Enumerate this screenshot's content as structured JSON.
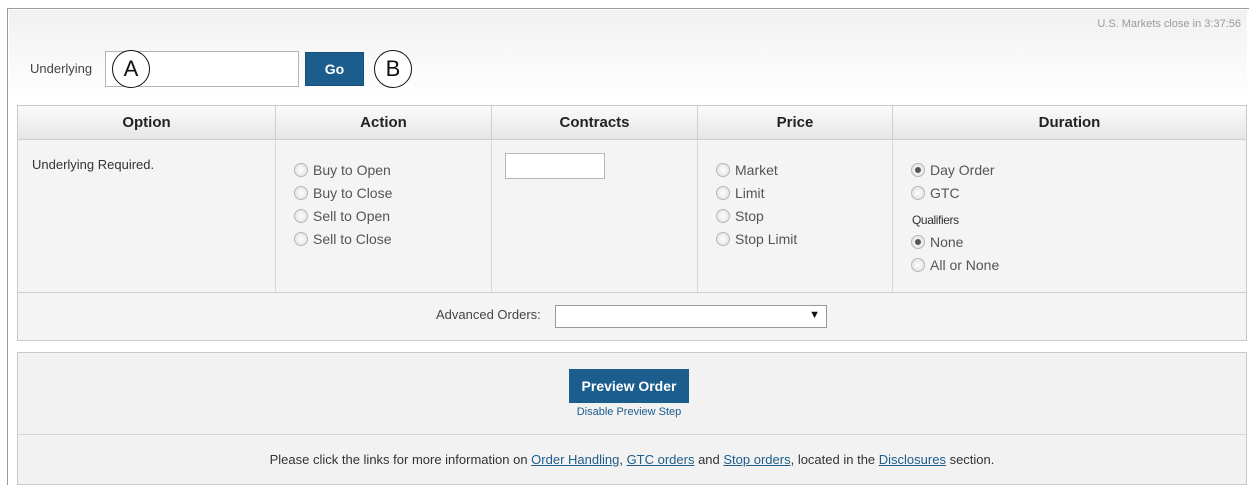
{
  "header": {
    "market_close": "U.S. Markets close in 3:37:56",
    "underlying_label": "Underlying",
    "underlying_value": "",
    "go_label": "Go",
    "callout_a": "A",
    "callout_b": "B"
  },
  "table": {
    "headers": [
      "Option",
      "Action",
      "Contracts",
      "Price",
      "Duration"
    ],
    "option_status": "Underlying Required.",
    "action_options": [
      "Buy to Open",
      "Buy to Close",
      "Sell to Open",
      "Sell to Close"
    ],
    "contracts_value": "",
    "price_options": [
      "Market",
      "Limit",
      "Stop",
      "Stop Limit"
    ],
    "duration_options": [
      "Day Order",
      "GTC"
    ],
    "duration_selected": "Day Order",
    "qualifiers_label": "Qualifiers",
    "qualifier_options": [
      "None",
      "All or None"
    ],
    "qualifier_selected": "None",
    "advanced_orders_label": "Advanced Orders:",
    "advanced_orders_value": ""
  },
  "preview": {
    "button_label": "Preview Order",
    "disable_link": "Disable Preview Step"
  },
  "info": {
    "text_1": "Please click the links for more information on ",
    "link_order_handling": "Order Handling",
    "text_2": ", ",
    "link_gtc": "GTC orders",
    "text_3": " and ",
    "link_stop": "Stop orders",
    "text_4": ", located in the ",
    "link_disclosures": "Disclosures",
    "text_5": " section."
  },
  "colors": {
    "button_blue": "#1b5e8e",
    "link_blue": "#1d5d8c"
  }
}
